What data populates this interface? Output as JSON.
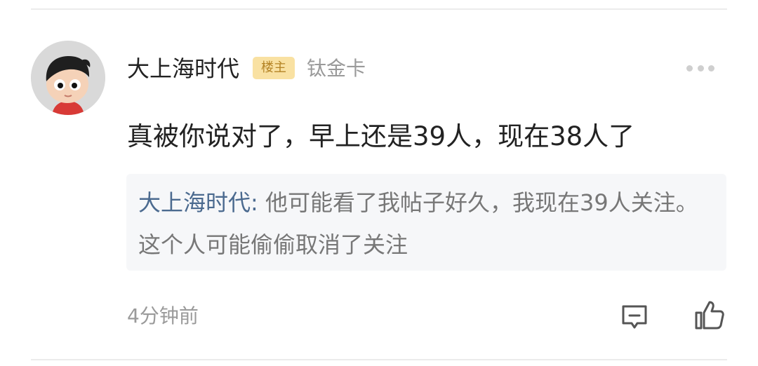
{
  "post": {
    "author": "大上海时代",
    "badge": "楼主",
    "level": "钛金卡",
    "comment": "真被你说对了，早上还是39人，现在38人了",
    "quote": {
      "author": "大上海时代",
      "separator": ": ",
      "text_line1": "他可能看了我帖子好久，我现在39人关注。",
      "text_line2": "这个人可能偷偷取消了关注"
    },
    "time": "4分钟前"
  },
  "icons": {
    "more": "more-horizontal-icon",
    "reply": "reply-comment-icon",
    "like": "thumbs-up-icon"
  },
  "colors": {
    "badge_bg": "#f9e1a2",
    "badge_text": "#b48324",
    "quote_name": "#4b6a8f",
    "quote_bg": "#f6f7f9"
  }
}
